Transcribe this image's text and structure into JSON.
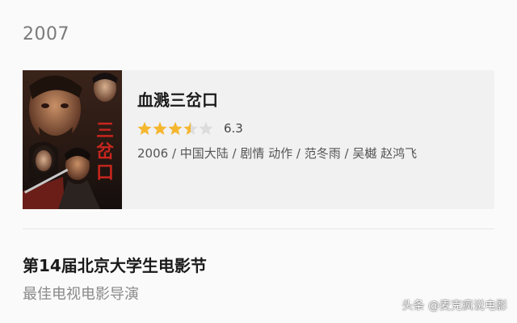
{
  "year": "2007",
  "movie": {
    "title": "血溅三岔口",
    "rating": 3.5,
    "max_rating": 5,
    "score": "6.3",
    "meta": "2006 / 中国大陆 / 剧情 动作 / 范冬雨 / 吴樾 赵鸿飞",
    "poster_text": "三岔口"
  },
  "award": {
    "name": "第14届北京大学生电影节",
    "category": "最佳电视电影导演"
  },
  "watermark": "头条 @麦克疯说电影",
  "colors": {
    "star_filled": "#f5b72f",
    "star_empty": "#dcdcdc",
    "poster_title": "#c8261e"
  }
}
